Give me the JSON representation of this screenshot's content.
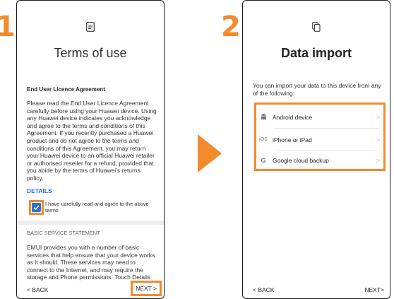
{
  "steps": {
    "one": "1",
    "two": "2"
  },
  "left": {
    "title": "Terms of use",
    "header_icon": "document-icon",
    "section_heading": "End User Licence Agreement",
    "body": "Please read the End User Licence Agreement carefully before using your Huawei device. Using any Huawei device indicates you acknowledge and agree to the terms and conditions of this Agreement. If you recently purchased a Huawei product and do not agree to the terms and conditions of this Agreement, you may return your Huawei device to an official Huawei retailer or authorised reseller for a refund, provided that you abide by the terms of Huawei's returns policy.",
    "details_link": "DETAILS",
    "agree_checkbox": {
      "checked": true,
      "label": "I have carefully read and agree to the above terms"
    },
    "basic_heading": "BASIC SERVICE STATEMENT",
    "basic_body": "EMUI provides you with a number of basic services that help ensure that your device works as it should. These services may need to connect to the Internet, and may require the storage and Phone permissions. Touch Details",
    "back": "< BACK",
    "next": "NEXT >"
  },
  "right": {
    "title": "Data import",
    "header_icon": "copy-icon",
    "intro": "You can import your data to this device from any of the following:",
    "options": [
      {
        "icon": "android-icon",
        "glyph": "",
        "label": "Android device"
      },
      {
        "icon": "ios-icon",
        "glyph": "iOS",
        "label": "iPhone or iPad"
      },
      {
        "icon": "google-icon",
        "glyph": "G",
        "label": "Google cloud backup"
      }
    ],
    "back": "< BACK",
    "next": "NEXT>"
  },
  "colors": {
    "accent": "#f28b2c",
    "link": "#2f6fd6"
  }
}
